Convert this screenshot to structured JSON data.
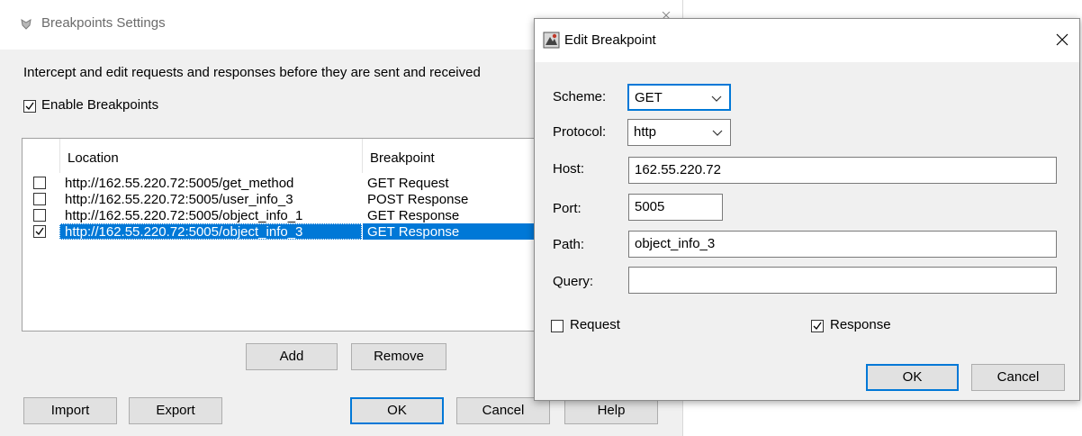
{
  "back_window": {
    "title": "Breakpoints Settings",
    "intro": "Intercept and edit requests and responses before they are sent and received",
    "enable_label": "Enable Breakpoints",
    "enable_checked": true,
    "columns": {
      "location": "Location",
      "breakpoint": "Breakpoint"
    },
    "rows": [
      {
        "location": "http://162.55.220.72:5005/get_method",
        "breakpoint": "GET Request",
        "checked": false,
        "selected": false
      },
      {
        "location": "http://162.55.220.72:5005/user_info_3",
        "breakpoint": "POST Response",
        "checked": false,
        "selected": false
      },
      {
        "location": "http://162.55.220.72:5005/object_info_1",
        "breakpoint": "GET Response",
        "checked": false,
        "selected": false
      },
      {
        "location": "http://162.55.220.72:5005/object_info_3",
        "breakpoint": "GET Response",
        "checked": true,
        "selected": true
      }
    ],
    "buttons": {
      "add": "Add",
      "remove": "Remove",
      "import": "Import",
      "export": "Export",
      "ok": "OK",
      "cancel": "Cancel",
      "help": "Help"
    }
  },
  "dialog": {
    "title": "Edit Breakpoint",
    "close_icon": "close-icon",
    "fields": {
      "scheme_label": "Scheme:",
      "scheme_value": "GET",
      "protocol_label": "Protocol:",
      "protocol_value": "http",
      "host_label": "Host:",
      "host_value": "162.55.220.72",
      "port_label": "Port:",
      "port_value": "5005",
      "path_label": "Path:",
      "path_value": "object_info_3",
      "query_label": "Query:",
      "query_value": ""
    },
    "request_label": "Request",
    "request_checked": false,
    "response_label": "Response",
    "response_checked": true,
    "buttons": {
      "ok": "OK",
      "cancel": "Cancel"
    }
  },
  "colors": {
    "accent": "#0078d7",
    "window_bg": "#f0f0f0"
  }
}
